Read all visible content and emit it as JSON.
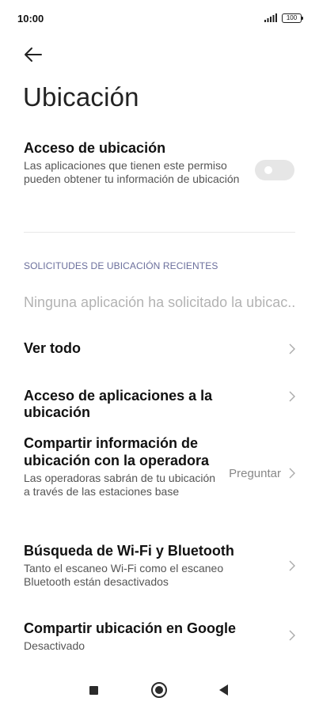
{
  "status_bar": {
    "time": "10:00",
    "battery": "100"
  },
  "header": {
    "title": "Ubicación"
  },
  "location_access": {
    "title": "Acceso de ubicación",
    "description": "Las aplicaciones que tienen este permiso pueden obtener tu información de ubicación",
    "enabled": false
  },
  "recent_requests": {
    "section_header": "SOLICITUDES DE UBICACIÓN RECIENTES",
    "empty_text": "Ninguna aplicación ha solicitado la ubicación recientemente"
  },
  "settings": [
    {
      "title": "Ver todo"
    },
    {
      "title": "Acceso de aplicaciones a la ubicación"
    },
    {
      "title": "Compartir información de ubicación con la operadora",
      "description": "Las operadoras sabrán de tu ubicación a través de las estaciones base",
      "value": "Preguntar"
    },
    {
      "title": "Búsqueda de Wi-Fi y Bluetooth",
      "description": "Tanto el escaneo Wi-Fi como el escaneo Bluetooth están desactivados"
    },
    {
      "title": "Compartir ubicación en Google",
      "description": "Desactivado"
    }
  ],
  "colors": {
    "section_header": "#6b6f9c",
    "toggle_off": "#e6e6e6",
    "muted_text": "#b3b3b3"
  }
}
